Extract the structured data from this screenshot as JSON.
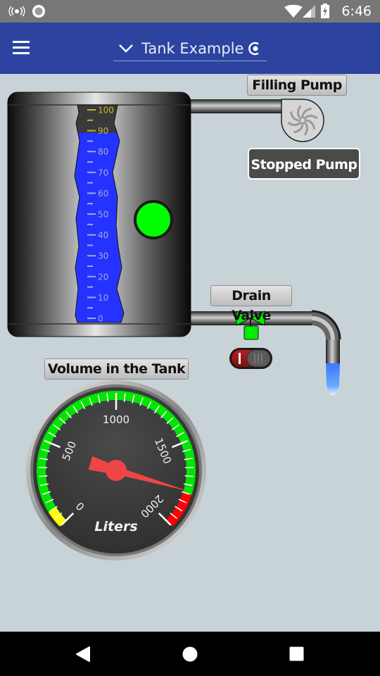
{
  "status_bar": {
    "time": "6:46",
    "icons": [
      "radio-broadcast-icon",
      "record-circle-icon",
      "wifi-icon",
      "cell-signal-icon",
      "battery-charging-icon"
    ]
  },
  "app_bar": {
    "menu_icon": "hamburger-menu-icon",
    "title": "Tank Example",
    "dropdown_icon": "chevron-down-icon",
    "trailing_icon": "loading-spinner-icon",
    "color": "#2c44a0"
  },
  "tank": {
    "level_percent": 89,
    "scale_labels": [
      "100",
      "90",
      "80",
      "70",
      "60",
      "50",
      "40",
      "30",
      "20",
      "10",
      "0"
    ],
    "liquid_color": "#2433ff",
    "indicator_color": "#00ff00"
  },
  "pump": {
    "label": "Filling Pump",
    "state_button": "Stopped Pump",
    "running": false
  },
  "drain_valve": {
    "label": "Drain Valve",
    "valve_color": "#00e600",
    "switch_on": false
  },
  "gauge": {
    "title": "Volume in the Tank",
    "unit": "Liters",
    "min": 0,
    "max": 2000,
    "value": 1785,
    "major_labels": [
      "0",
      "500",
      "1000",
      "1500",
      "2000"
    ],
    "major_step": 500,
    "minor_step": 50,
    "zones": [
      {
        "from": 0,
        "to": 100,
        "color": "#ffff00"
      },
      {
        "from": 100,
        "to": 1800,
        "color": "#00e600"
      },
      {
        "from": 1800,
        "to": 2000,
        "color": "#ff0000"
      }
    ],
    "needle_color": "#f04545"
  },
  "nav_bar": {
    "back_icon": "back-triangle-icon",
    "home_icon": "home-circle-icon",
    "recents_icon": "recents-square-icon"
  }
}
